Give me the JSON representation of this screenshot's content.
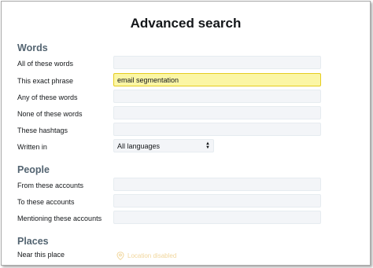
{
  "title": "Advanced search",
  "sections": {
    "words": "Words",
    "people": "People",
    "places": "Places"
  },
  "words": {
    "all_label": "All of these words",
    "all_value": "",
    "exact_label": "This exact phrase",
    "exact_value": "email segmentation",
    "any_label": "Any of these words",
    "any_value": "",
    "none_label": "None of these words",
    "none_value": "",
    "hashtags_label": "These hashtags",
    "hashtags_value": "",
    "language_label": "Written in",
    "language_value": "All languages"
  },
  "people": {
    "from_label": "From these accounts",
    "from_value": "",
    "to_label": "To these accounts",
    "to_value": "",
    "mentioning_label": "Mentioning these accounts",
    "mentioning_value": ""
  },
  "places": {
    "near_label": "Near this place",
    "location_status": "Location disabled",
    "location_icon": "location-pin-icon"
  },
  "colors": {
    "active_field_bg": "#fbf6a5",
    "active_field_border": "#e5cc1f",
    "section_heading": "#536471",
    "location_disabled": "#f1d69c"
  }
}
